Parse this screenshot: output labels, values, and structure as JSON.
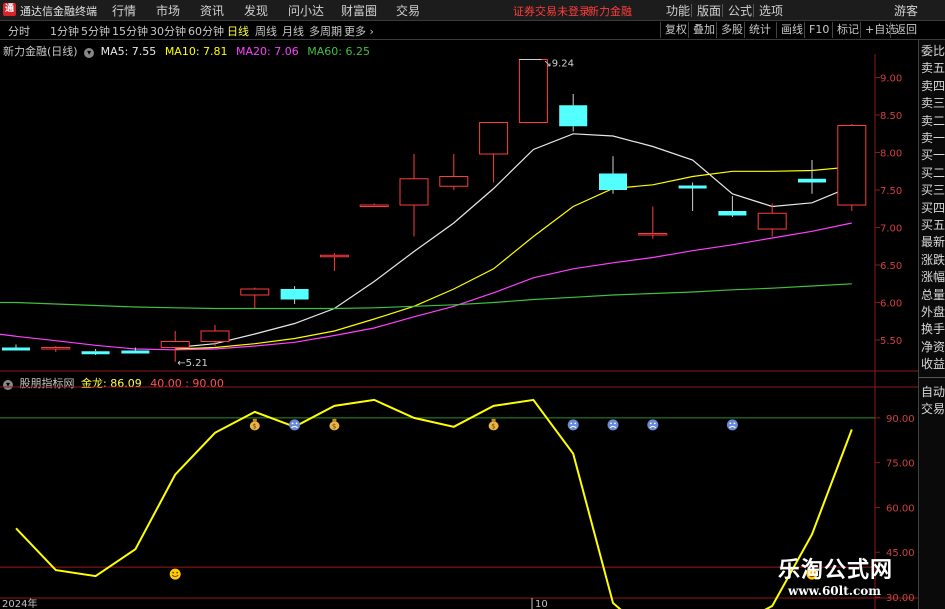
{
  "titlebar": {
    "app_title": "通达信金融终端",
    "menus": [
      "行情",
      "市场",
      "资讯",
      "发现",
      "问小达",
      "财富圈",
      "交易"
    ],
    "warning": "证券交易未登录",
    "stock_name": "新力金融",
    "right_buttons": [
      "功能",
      "版面",
      "公式",
      "选项"
    ],
    "guest": "游客"
  },
  "periods": {
    "items": [
      "分时",
      "1分钟",
      "5分钟",
      "15分钟",
      "30分钟",
      "60分钟",
      "日线",
      "周线",
      "月线",
      "多周期",
      "更多"
    ],
    "active": "日线"
  },
  "toolbar_right": [
    "复权",
    "叠加",
    "多股",
    "统计",
    "画线",
    "F10",
    "标记",
    "+自选",
    "返回"
  ],
  "main_chart": {
    "title": "新力金融(日线)",
    "ma": [
      {
        "label": "MA5: 7.55",
        "color": "#e8e8e8"
      },
      {
        "label": "MA10: 7.81",
        "color": "#ffff00"
      },
      {
        "label": "MA20: 7.06",
        "color": "#ff40ff"
      },
      {
        "label": "MA60: 6.25",
        "color": "#40c040"
      }
    ],
    "y_ticks": [
      "9.00",
      "8.50",
      "8.00",
      "7.50",
      "7.00",
      "6.50",
      "6.00",
      "5.50"
    ],
    "high_label": "9.24",
    "low_label": "5.21"
  },
  "indicator": {
    "title": "股朋指标网",
    "line_label": "金龙: 86.09",
    "levels_label": "40.00 : 90.00",
    "y_ticks": [
      "90.00",
      "75.00",
      "60.00",
      "45.00",
      "30.00"
    ]
  },
  "x_axis": {
    "labels": [
      "2024年",
      "10"
    ]
  },
  "right_tabs": [
    "委比",
    "卖五",
    "卖四",
    "卖三",
    "卖二",
    "卖一",
    "买一",
    "买二",
    "买三",
    "买四",
    "买五",
    "最新",
    "涨跌",
    "涨幅",
    "总量",
    "外盘",
    "换手",
    "净资",
    "收益",
    "自动",
    "交易"
  ],
  "watermark": {
    "line1": "乐淘公式网",
    "line2": "www.60lt.com"
  },
  "chart_data": [
    {
      "type": "candlestick",
      "y_range": [
        5.1,
        9.3
      ],
      "candles": [
        {
          "o": 5.4,
          "h": 5.44,
          "l": 5.36,
          "c": 5.38
        },
        {
          "o": 5.38,
          "h": 5.42,
          "l": 5.34,
          "c": 5.4
        },
        {
          "o": 5.35,
          "h": 5.38,
          "l": 5.3,
          "c": 5.33
        },
        {
          "o": 5.36,
          "h": 5.4,
          "l": 5.32,
          "c": 5.34
        },
        {
          "o": 5.4,
          "h": 5.62,
          "l": 5.21,
          "c": 5.48
        },
        {
          "o": 5.48,
          "h": 5.7,
          "l": 5.42,
          "c": 5.62
        },
        {
          "o": 6.1,
          "h": 6.2,
          "l": 5.92,
          "c": 6.18
        },
        {
          "o": 6.18,
          "h": 6.22,
          "l": 5.98,
          "c": 6.04
        },
        {
          "o": 6.63,
          "h": 6.66,
          "l": 6.42,
          "c": 6.63
        },
        {
          "o": 7.3,
          "h": 7.32,
          "l": 7.28,
          "c": 7.3
        },
        {
          "o": 7.3,
          "h": 7.98,
          "l": 6.88,
          "c": 7.65
        },
        {
          "o": 7.55,
          "h": 7.98,
          "l": 7.5,
          "c": 7.68
        },
        {
          "o": 7.98,
          "h": 8.4,
          "l": 7.6,
          "c": 8.4
        },
        {
          "o": 8.4,
          "h": 9.24,
          "l": 8.4,
          "c": 9.24
        },
        {
          "o": 8.63,
          "h": 8.78,
          "l": 8.28,
          "c": 8.35
        },
        {
          "o": 7.72,
          "h": 7.95,
          "l": 7.45,
          "c": 7.5
        },
        {
          "o": 6.9,
          "h": 7.28,
          "l": 6.85,
          "c": 6.92
        },
        {
          "o": 7.56,
          "h": 7.6,
          "l": 7.22,
          "c": 7.52
        },
        {
          "o": 7.22,
          "h": 7.42,
          "l": 7.14,
          "c": 7.16
        },
        {
          "o": 6.98,
          "h": 7.32,
          "l": 6.88,
          "c": 7.19
        },
        {
          "o": 7.65,
          "h": 7.9,
          "l": 7.45,
          "c": 7.6
        },
        {
          "o": 7.3,
          "h": 8.38,
          "l": 7.22,
          "c": 8.36
        }
      ],
      "series": [
        {
          "name": "MA5",
          "color": "#e8e8e8",
          "values": [
            null,
            null,
            null,
            null,
            5.4,
            5.45,
            5.58,
            5.72,
            5.92,
            6.28,
            6.68,
            7.06,
            7.52,
            8.04,
            8.25,
            8.22,
            8.08,
            7.9,
            7.45,
            7.28,
            7.33,
            7.55
          ]
        },
        {
          "name": "MA10",
          "color": "#ffff00",
          "values": [
            null,
            null,
            null,
            null,
            5.38,
            5.4,
            5.45,
            5.52,
            5.62,
            5.78,
            5.95,
            6.18,
            6.45,
            6.88,
            7.28,
            7.52,
            7.57,
            7.68,
            7.75,
            7.75,
            7.76,
            7.81
          ]
        },
        {
          "name": "MA20",
          "color": "#ff40ff",
          "values": [
            5.55,
            5.49,
            5.43,
            5.38,
            5.37,
            5.38,
            5.42,
            5.47,
            5.56,
            5.66,
            5.81,
            5.95,
            6.13,
            6.33,
            6.45,
            6.53,
            6.6,
            6.69,
            6.77,
            6.86,
            6.95,
            7.06
          ]
        },
        {
          "name": "MA60",
          "color": "#40c040",
          "values": [
            6.0,
            5.98,
            5.96,
            5.94,
            5.93,
            5.92,
            5.92,
            5.92,
            5.92,
            5.93,
            5.95,
            5.97,
            6.0,
            6.04,
            6.07,
            6.1,
            6.12,
            6.14,
            6.17,
            6.19,
            6.22,
            6.25
          ]
        }
      ]
    },
    {
      "type": "line",
      "y_range": [
        30,
        100
      ],
      "levels": [
        40,
        90
      ],
      "series": [
        {
          "name": "金龙",
          "color": "#ffff00",
          "values": [
            53,
            39,
            37,
            46,
            71,
            85,
            92,
            87,
            94,
            96,
            90,
            87,
            94,
            96,
            78,
            28,
            15,
            23,
            20,
            27,
            51,
            86.09
          ]
        }
      ],
      "markers": [
        {
          "index": 4,
          "kind": "happy"
        },
        {
          "index": 6,
          "kind": "money"
        },
        {
          "index": 7,
          "kind": "sad"
        },
        {
          "index": 8,
          "kind": "money"
        },
        {
          "index": 12,
          "kind": "money"
        },
        {
          "index": 14,
          "kind": "sad"
        },
        {
          "index": 15,
          "kind": "sad"
        },
        {
          "index": 16,
          "kind": "sad"
        },
        {
          "index": 18,
          "kind": "sad"
        },
        {
          "index": 20,
          "kind": "happy"
        }
      ]
    }
  ]
}
